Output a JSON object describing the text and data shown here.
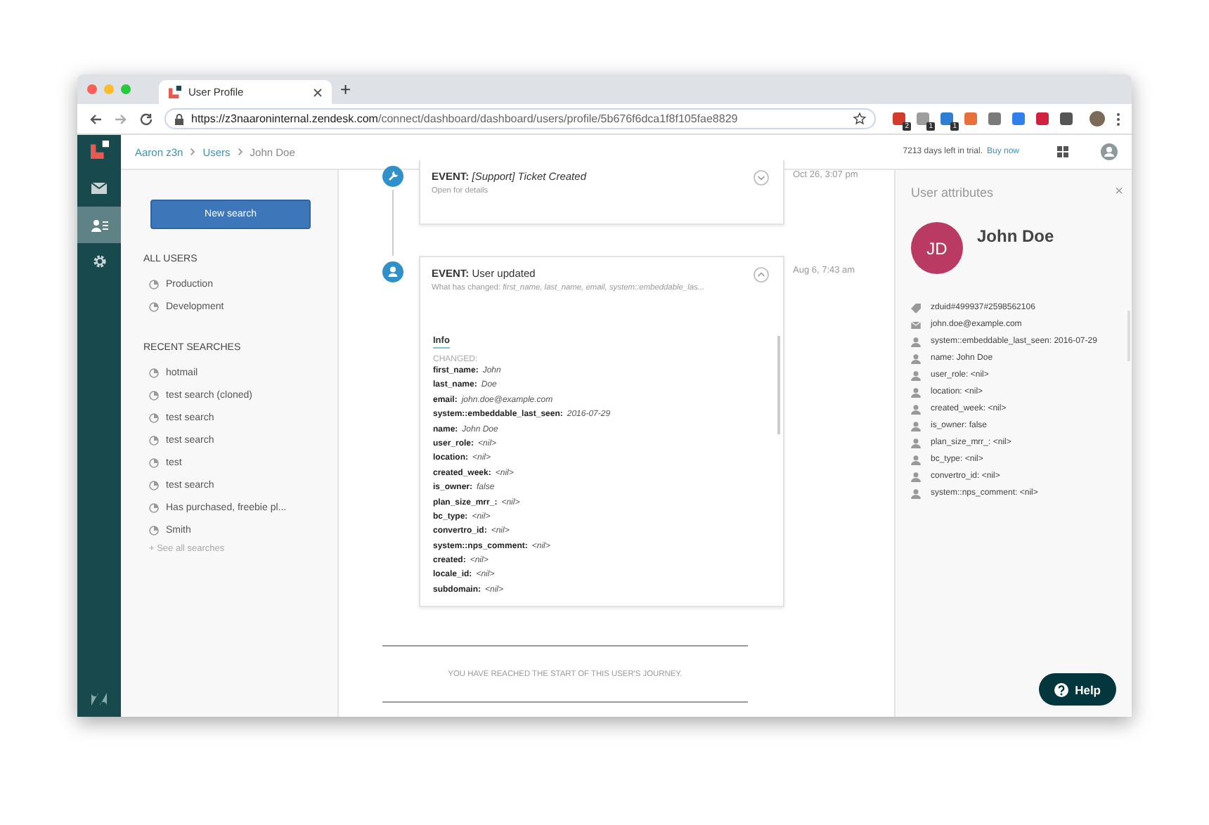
{
  "browser": {
    "tab_title": "User Profile",
    "new_tab": "+",
    "url_host": "https://z3naaroninternal.zendesk.com",
    "url_path": "/connect/dashboard/dashboard/users/profile/5b676f6dca1f8f105fae8829",
    "extensions": [
      {
        "color": "#d33b2c",
        "badge": "2"
      },
      {
        "color": "#9e9e9e",
        "badge": "1"
      },
      {
        "color": "#2d7fd3",
        "badge": "1"
      },
      {
        "color": "#e8703a"
      },
      {
        "color": "#7a7a7a"
      },
      {
        "color": "#2f80ed"
      },
      {
        "color": "#d0213f"
      },
      {
        "color": "#555555"
      }
    ]
  },
  "header": {
    "breadcrumb": [
      {
        "label": "Aaron z3n",
        "link": true
      },
      {
        "label": "Users",
        "link": true
      },
      {
        "label": "John Doe",
        "link": false
      }
    ],
    "trial_text": "7213 days left in trial.",
    "buy_link": "Buy now"
  },
  "nav": [
    {
      "kind": "mail",
      "selected": false
    },
    {
      "kind": "users",
      "selected": true
    },
    {
      "kind": "settings",
      "selected": false
    }
  ],
  "left_panel": {
    "new_search_button": "New search",
    "sections": [
      {
        "heading": "ALL USERS",
        "items": [
          "Production",
          "Development"
        ]
      },
      {
        "heading": "RECENT SEARCHES",
        "items": [
          "hotmail",
          "test search (cloned)",
          "test search",
          "test search",
          "test",
          "test search",
          "Has purchased, freebie pl...",
          "Smith"
        ]
      }
    ],
    "see_all": "+ See all searches"
  },
  "timeline": {
    "events": [
      {
        "kind": "ticket",
        "title": "**EVENT:** *[Support] Ticket Created*",
        "subtitle": "Open for details",
        "time": "Oct 26, 3:07 pm",
        "expanded": false
      },
      {
        "kind": "user",
        "title": "**EVENT:** User updated",
        "subtitle": "What has changed: *first_name, last_name, email, system::embeddable_las...*",
        "time": "Aug 6, 7:43 am",
        "expanded": true,
        "tab": "Info",
        "changed_label": "CHANGED:",
        "changes": [
          {
            "key": "first_name:",
            "value": "John"
          },
          {
            "key": "last_name:",
            "value": "Doe"
          },
          {
            "key": "email:",
            "value": "john.doe@example.com"
          },
          {
            "key": "system::embeddable_last_seen:",
            "value": "2016-07-29"
          },
          {
            "key": "name:",
            "value": "John Doe"
          },
          {
            "key": "user_role:",
            "value": "<nil>"
          },
          {
            "key": "location:",
            "value": "<nil>"
          },
          {
            "key": "created_week:",
            "value": "<nil>"
          },
          {
            "key": "is_owner:",
            "value": "false"
          },
          {
            "key": "plan_size_mrr_:",
            "value": "<nil>"
          },
          {
            "key": "bc_type:",
            "value": "<nil>"
          },
          {
            "key": "convertro_id:",
            "value": "<nil>"
          },
          {
            "key": "system::nps_comment:",
            "value": "<nil>"
          },
          {
            "key": "created:",
            "value": "<nil>"
          },
          {
            "key": "locale_id:",
            "value": "<nil>"
          },
          {
            "key": "subdomain:",
            "value": "<nil>"
          }
        ]
      }
    ],
    "journey_end": "YOU HAVE REACHED THE START OF THIS USER'S JOURNEY."
  },
  "attributes_panel": {
    "title": "User attributes",
    "close": "×",
    "initials": "JD",
    "name": "John Doe",
    "attributes": [
      {
        "kind": "tag",
        "text": "zduid#499937#2598562106"
      },
      {
        "kind": "email",
        "text": "john.doe@example.com"
      },
      {
        "kind": "user",
        "text": "system::embeddable_last_seen: 2016-07-29"
      },
      {
        "kind": "user",
        "text": "name: John Doe"
      },
      {
        "kind": "user",
        "text": "user_role: <nil>"
      },
      {
        "kind": "user",
        "text": "location: <nil>"
      },
      {
        "kind": "user",
        "text": "created_week: <nil>"
      },
      {
        "kind": "user",
        "text": "is_owner: false"
      },
      {
        "kind": "user",
        "text": "plan_size_mrr_: <nil>"
      },
      {
        "kind": "user",
        "text": "bc_type: <nil>"
      },
      {
        "kind": "user",
        "text": "convertro_id: <nil>"
      },
      {
        "kind": "user",
        "text": "system::nps_comment: <nil>"
      }
    ]
  },
  "help_button": "Help"
}
